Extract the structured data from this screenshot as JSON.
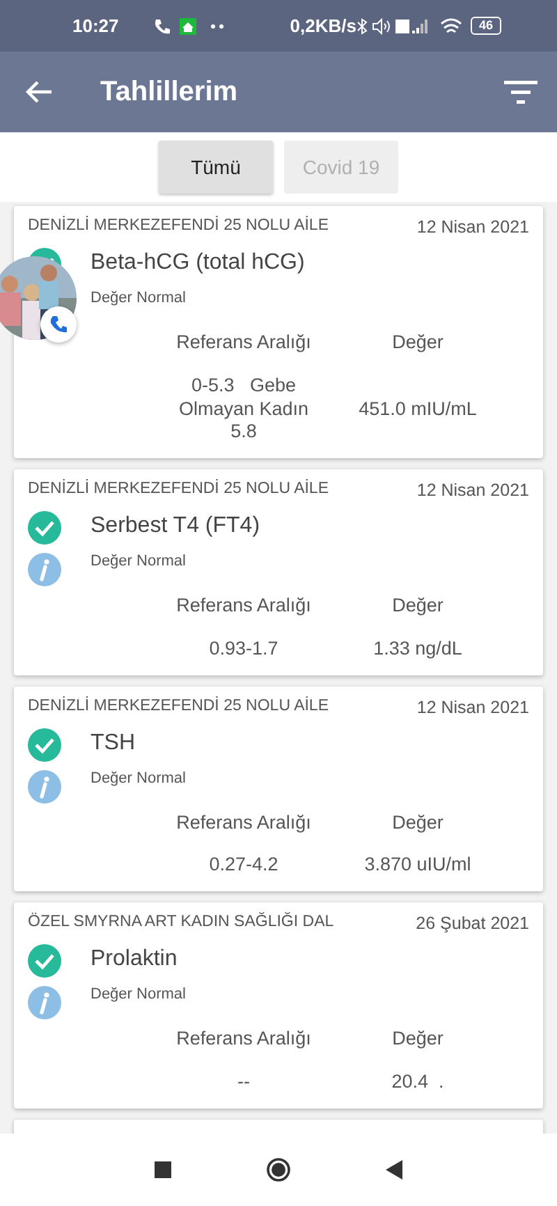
{
  "status_bar": {
    "time": "10:27",
    "speed": "0,2KB/s",
    "battery": "46"
  },
  "header": {
    "title": "Tahlillerim"
  },
  "tabs": [
    {
      "label": "Tümü",
      "selected": true
    },
    {
      "label": "Covid 19",
      "selected": false
    }
  ],
  "results": [
    {
      "source": "DENİZLİ MERKEZEFENDİ 25 NOLU AİLE",
      "date": "12 Nisan 2021",
      "name": "Beta-hCG (total hCG)",
      "status": "Değer Normal",
      "range_label": "Referans Aralığı",
      "value_label": "Değer",
      "range": "0-5.3   Gebe Olmayan Kadın 5.8",
      "value": "451.0 mIU/mL"
    },
    {
      "source": "DENİZLİ MERKEZEFENDİ 25 NOLU AİLE",
      "date": "12 Nisan 2021",
      "name": "Serbest T4 (FT4)",
      "status": "Değer Normal",
      "range_label": "Referans Aralığı",
      "value_label": "Değer",
      "range": "0.93-1.7",
      "value": "1.33 ng/dL"
    },
    {
      "source": "DENİZLİ MERKEZEFENDİ 25 NOLU AİLE",
      "date": "12 Nisan 2021",
      "name": "TSH",
      "status": "Değer Normal",
      "range_label": "Referans Aralığı",
      "value_label": "Değer",
      "range": "0.27-4.2",
      "value": "3.870 uIU/ml"
    },
    {
      "source": "ÖZEL SMYRNA ART KADIN SAĞLIĞI DAL",
      "date": "26 Şubat 2021",
      "name": "Prolaktin",
      "status": "Değer Normal",
      "range_label": "Referans Aralığı",
      "value_label": "Değer",
      "range": "--",
      "value": "20.4  ."
    }
  ]
}
